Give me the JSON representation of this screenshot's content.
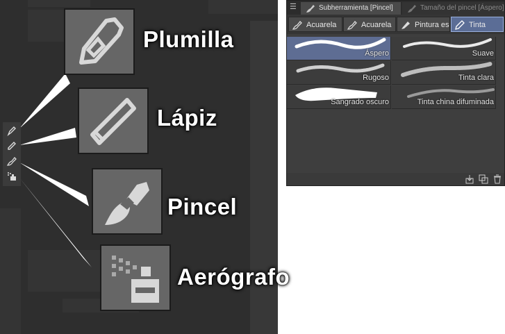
{
  "callouts": {
    "pen": {
      "label": "Plumilla",
      "icon": "pen-nib-icon"
    },
    "pencil": {
      "label": "Lápiz",
      "icon": "pencil-icon"
    },
    "brush": {
      "label": "Pincel",
      "icon": "brush-icon"
    },
    "airbrush": {
      "label": "Aerógrafo",
      "icon": "airbrush-icon"
    }
  },
  "panel": {
    "tabs": [
      {
        "label": "Subherramienta [Pincel]",
        "icon": "brush-tab-icon",
        "active": true
      },
      {
        "label": "Tamaño del pincel [Áspero]",
        "icon": "brush-size-icon",
        "active": false
      }
    ],
    "groups": [
      {
        "label": "Acuarela",
        "icon": "brush-icon",
        "active": false
      },
      {
        "label": "Acuarela",
        "icon": "brush-icon",
        "active": false
      },
      {
        "label": "Pintura espesa",
        "icon": "paint-brush-icon",
        "active": false
      },
      {
        "label": "Tinta",
        "icon": "ink-brush-icon",
        "active": true
      }
    ],
    "brushes": [
      {
        "name": "Áspero",
        "selected": true
      },
      {
        "name": "Suave",
        "selected": false
      },
      {
        "name": "Rugoso",
        "selected": false
      },
      {
        "name": "Tinta clara",
        "selected": false
      },
      {
        "name": "Sangrado oscuro",
        "selected": false
      },
      {
        "name": "Tinta china difuminada",
        "selected": false
      }
    ],
    "footer_icons": [
      "import-icon",
      "duplicate-icon",
      "trash-icon"
    ]
  },
  "colors": {
    "accent_selected": "#5e6d93",
    "icon_tile": "#666666",
    "callout_wedge": "#ffffff"
  }
}
